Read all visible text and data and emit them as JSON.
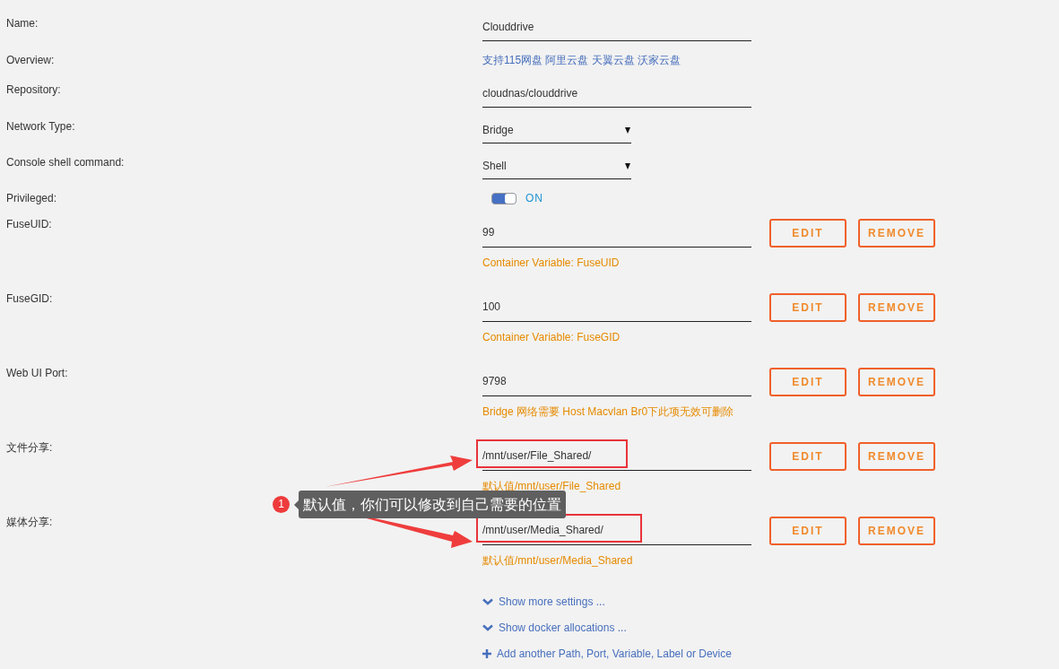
{
  "fields": [
    {
      "kind": "text",
      "label": "Name:",
      "value": "Clouddrive"
    },
    {
      "kind": "info",
      "label": "Overview:",
      "value": "支持115网盘 阿里云盘 天翼云盘 沃家云盘"
    },
    {
      "kind": "text",
      "label": "Repository:",
      "value": "cloudnas/clouddrive"
    },
    {
      "kind": "select",
      "label": "Network Type:",
      "value": "Bridge"
    },
    {
      "kind": "select",
      "label": "Console shell command:",
      "value": "Shell"
    },
    {
      "kind": "toggle",
      "label": "Privileged:",
      "on": true,
      "state_label": "ON"
    },
    {
      "kind": "variable",
      "label": "FuseUID:",
      "value": "99",
      "description": "Container Variable: FuseUID",
      "edit": "EDIT",
      "remove": "REMOVE",
      "highlighted": false
    },
    {
      "kind": "variable",
      "label": "FuseGID:",
      "value": "100",
      "description": "Container Variable: FuseGID",
      "edit": "EDIT",
      "remove": "REMOVE",
      "highlighted": false
    },
    {
      "kind": "variable",
      "label": "Web UI Port:",
      "value": "9798",
      "description": "Bridge 网络需要 Host Macvlan Br0下此项无效可删除",
      "edit": "EDIT",
      "remove": "REMOVE",
      "highlighted": false
    },
    {
      "kind": "variable",
      "label": "文件分享:",
      "value": "/mnt/user/File_Shared/",
      "description": "默认值/mnt/user/File_Shared",
      "edit": "EDIT",
      "remove": "REMOVE",
      "highlighted": true
    },
    {
      "kind": "variable",
      "label": "媒体分享:",
      "value": "/mnt/user/Media_Shared/",
      "description": "默认值/mnt/user/Media_Shared",
      "edit": "EDIT",
      "remove": "REMOVE",
      "highlighted": true
    }
  ],
  "links": [
    {
      "kind": "expand",
      "label": "Show more settings ..."
    },
    {
      "kind": "expand",
      "label": "Show docker allocations ..."
    },
    {
      "kind": "add",
      "label": "Add another Path, Port, Variable, Label or Device"
    }
  ],
  "annotation": {
    "number": "1",
    "text": "默认值，你们可以修改到自己需要的位置"
  }
}
